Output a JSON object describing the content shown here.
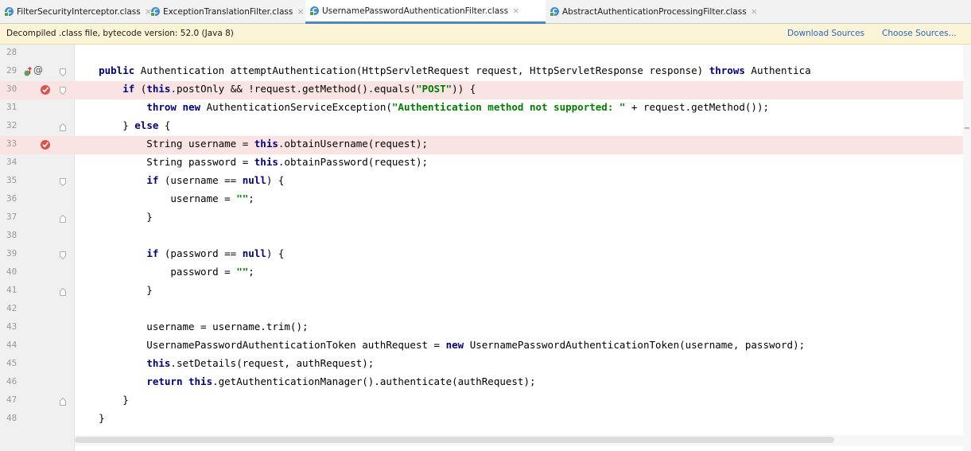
{
  "tabs": [
    {
      "label": "FilterSecurityInterceptor.class",
      "icon": "class-icon",
      "active": false
    },
    {
      "label": "ExceptionTranslationFilter.class",
      "icon": "class-icon",
      "active": false
    },
    {
      "label": "UsernamePasswordAuthenticationFilter.class",
      "icon": "class-icon",
      "active": true
    },
    {
      "label": "AbstractAuthenticationProcessingFilter.class",
      "icon": "class-icon",
      "active": false
    }
  ],
  "tab_close_glyph": "×",
  "notice": {
    "text": "Decompiled .class file, bytecode version: 52.0 (Java 8)",
    "download_sources": "Download Sources",
    "choose_sources": "Choose Sources..."
  },
  "editor": {
    "line_numbers": [
      "28",
      "29",
      "30",
      "31",
      "32",
      "33",
      "34",
      "35",
      "36",
      "37",
      "38",
      "39",
      "40",
      "41",
      "42",
      "43",
      "44",
      "45",
      "46",
      "47",
      "48"
    ],
    "breakpoint_lines": [
      "30",
      "33"
    ],
    "code_lines": [
      "",
      "    public Authentication attemptAuthentication(HttpServletRequest request, HttpServletResponse response) throws Authentica",
      "        if (this.postOnly && !request.getMethod().equals(\"POST\")) {",
      "            throw new AuthenticationServiceException(\"Authentication method not supported: \" + request.getMethod());",
      "        } else {",
      "            String username = this.obtainUsername(request);",
      "            String password = this.obtainPassword(request);",
      "            if (username == null) {",
      "                username = \"\";",
      "            }",
      "",
      "            if (password == null) {",
      "                password = \"\";",
      "            }",
      "",
      "            username = username.trim();",
      "            UsernamePasswordAuthenticationToken authRequest = new UsernamePasswordAuthenticationToken(username, password);",
      "            this.setDetails(request, authRequest);",
      "            return this.getAuthenticationManager().authenticate(authRequest);",
      "        }",
      "    }"
    ],
    "gutter_icons": {
      "line_29": [
        "implements-icon",
        "annotation-icon"
      ],
      "line_30": "breakpoint-icon",
      "line_33": "breakpoint-icon"
    },
    "colors": {
      "keyword": "#000080",
      "string": "#008000",
      "breakpoint_line": "#fae3e3",
      "link": "#2b66c2",
      "notice_bg": "#fcf4d6"
    }
  }
}
